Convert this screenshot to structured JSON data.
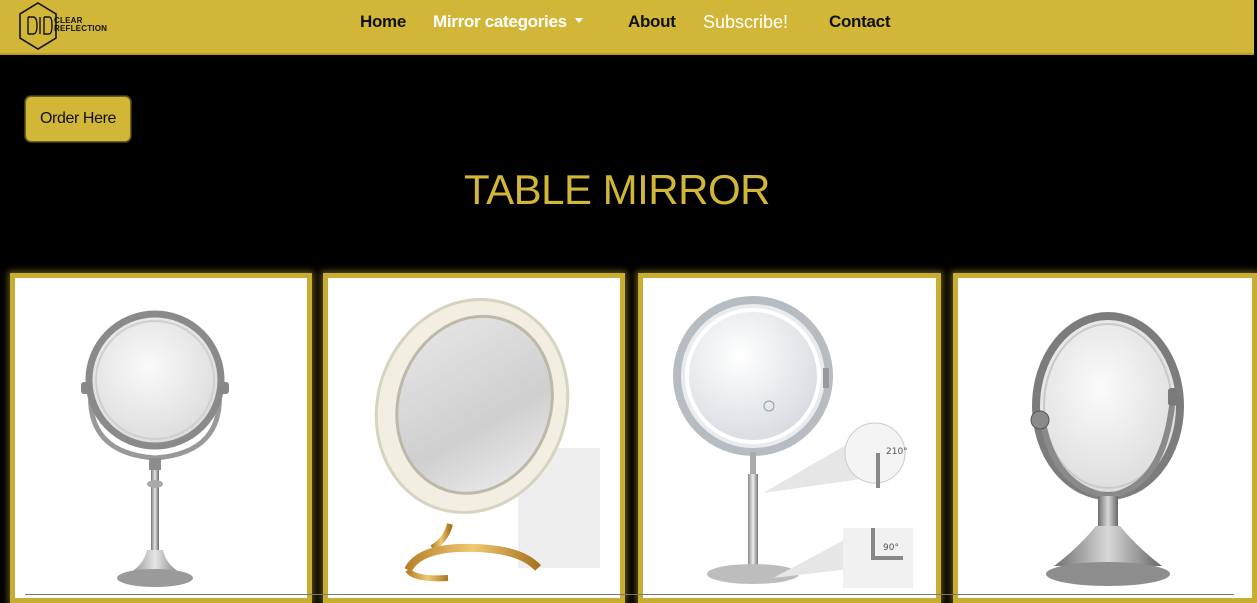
{
  "brand": {
    "line1": "CLEAR",
    "line2": "REFLECTION",
    "icon": "hexagon-logo-icon"
  },
  "nav": {
    "items": [
      {
        "label": "Home"
      },
      {
        "label": "Mirror categories"
      },
      {
        "label": "About"
      },
      {
        "label": "Subscribe!"
      },
      {
        "label": "Contact"
      }
    ]
  },
  "order_button": {
    "label": "Order Here"
  },
  "page_title": "TABLE MIRROR",
  "products": [
    {
      "image": "round-metal-table-mirror"
    },
    {
      "image": "cream-round-mirror-gold-stand"
    },
    {
      "image": "lighted-magnifying-vanity-mirror"
    },
    {
      "image": "oval-pewter-table-mirror"
    }
  ],
  "colors": {
    "accent": "#d1b637",
    "background": "#000000"
  }
}
